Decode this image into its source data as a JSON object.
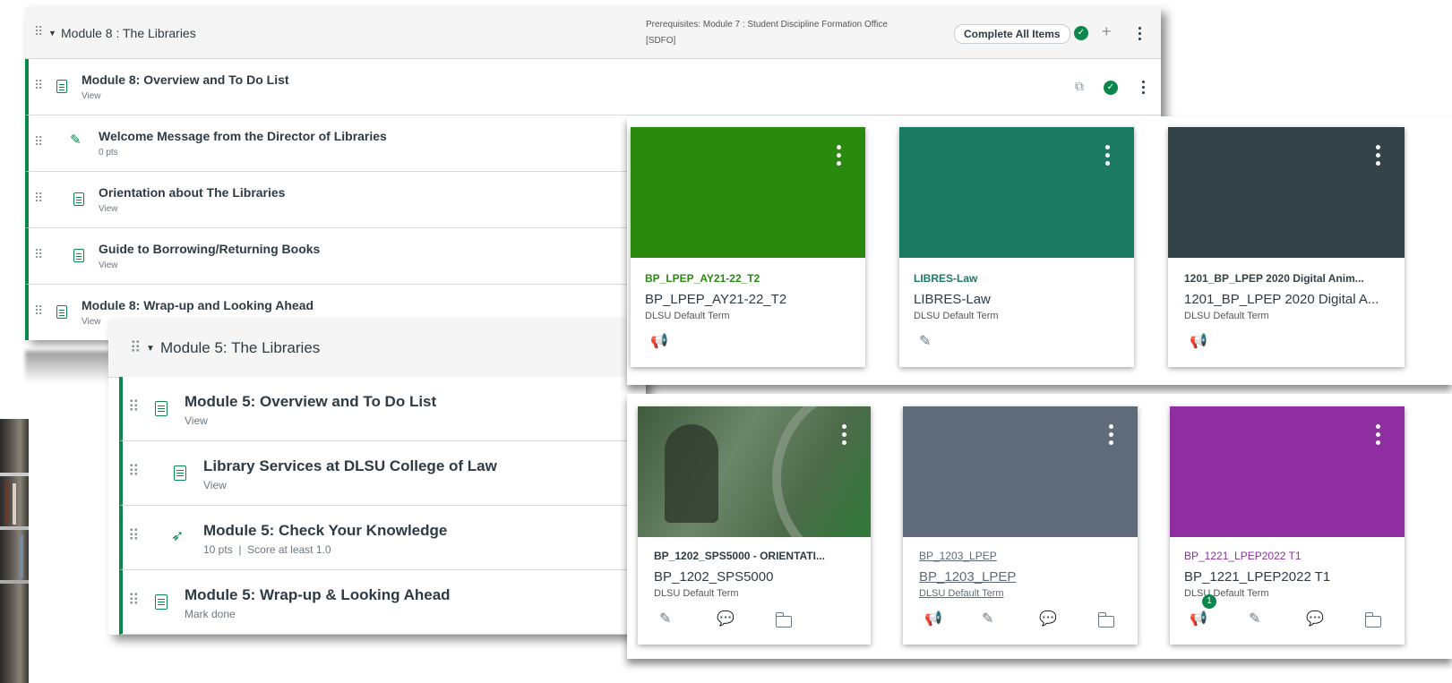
{
  "module8": {
    "title": "Module 8 : The Libraries",
    "prereq_line1": "Prerequisites: Module 7 : Student Discipline Formation Office",
    "prereq_line2": "[SDFO]",
    "complete_all": "Complete All Items",
    "items": [
      {
        "title": "Module 8: Overview and To Do List",
        "sub": "View"
      },
      {
        "title": "Welcome Message from the Director of Libraries",
        "sub": "0 pts"
      },
      {
        "title": "Orientation about The Libraries",
        "sub": "View"
      },
      {
        "title": "Guide to Borrowing/Returning Books",
        "sub": "View"
      },
      {
        "title": "Module 8: Wrap-up and Looking Ahead",
        "sub": "View"
      }
    ]
  },
  "module5": {
    "title": "Module 5: The Libraries",
    "items": [
      {
        "title": "Module 5: Overview and To Do List",
        "sub": "View"
      },
      {
        "title": "Library Services at DLSU College of Law",
        "sub": "View"
      },
      {
        "title": "Module 5: Check Your Knowledge",
        "sub": "10 pts  |  Score at least 1.0"
      },
      {
        "title": "Module 5: Wrap-up & Looking Ahead",
        "sub": "Mark done"
      }
    ]
  },
  "cards": [
    {
      "code": "BP_LPEP_AY21-22_T2",
      "name": "BP_LPEP_AY21-22_T2",
      "term": "DLSU Default Term",
      "color": "#2a8a10",
      "code_color": "#2a8a10"
    },
    {
      "code": "LIBRES-Law",
      "name": "LIBRES-Law",
      "term": "DLSU Default Term",
      "color": "#1a7a62",
      "code_color": "#1a7a62"
    },
    {
      "code": "1201_BP_LPEP 2020 Digital Anim...",
      "name": "1201_BP_LPEP 2020 Digital A...",
      "term": "DLSU Default Term",
      "color": "#334347",
      "code_color": "#334347"
    },
    {
      "code": "BP_1202_SPS5000 - ORIENTATI...",
      "name": "BP_1202_SPS5000",
      "term": "DLSU Default Term",
      "color": "#4d6b4a",
      "code_color": "#2d3b45"
    },
    {
      "code": "BP_1203_LPEP",
      "name": "BP_1203_LPEP",
      "term": "DLSU Default Term",
      "color": "#5f6b78",
      "code_color": "#5f6b78"
    },
    {
      "code": "BP_1221_LPEP2022 T1",
      "name": "BP_1221_LPEP2022 T1",
      "term": "DLSU Default Term",
      "color": "#8e2ea0",
      "code_color": "#8e2ea0"
    }
  ],
  "badge_count": "1"
}
